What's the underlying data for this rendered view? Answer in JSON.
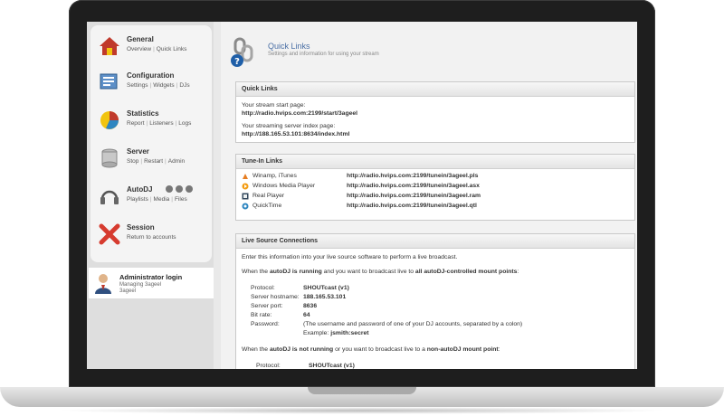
{
  "nav": {
    "general": {
      "title": "General",
      "links": [
        "Overview",
        "Quick Links"
      ]
    },
    "configuration": {
      "title": "Configuration",
      "links": [
        "Settings",
        "Widgets",
        "DJs"
      ]
    },
    "statistics": {
      "title": "Statistics",
      "links": [
        "Report",
        "Listeners",
        "Logs"
      ]
    },
    "server": {
      "title": "Server",
      "links": [
        "Stop",
        "Restart",
        "Admin"
      ]
    },
    "autodj": {
      "title": "AutoDJ",
      "links": [
        "Playlists",
        "Media",
        "Files"
      ]
    },
    "session": {
      "title": "Session",
      "links": [
        "Return to accounts"
      ]
    }
  },
  "login": {
    "title": "Administrator login",
    "sub1": "Managing 3ageel",
    "sub2": "3ageel"
  },
  "header": {
    "title": "Quick Links",
    "subtitle": "Settings and information for using your stream"
  },
  "quick_links": {
    "title": "Quick Links",
    "start_label": "Your stream start page:",
    "start_url": "http://radio.hvips.com:2199/start/3ageel",
    "index_label": "Your streaming server index page:",
    "index_url": "http://188.165.53.101:8634/index.html"
  },
  "tunein": {
    "title": "Tune-In Links",
    "rows": [
      {
        "player": "Winamp, iTunes",
        "icon": "winamp-icon",
        "url": "http://radio.hvips.com:2199/tunein/3ageel.pls"
      },
      {
        "player": "Windows Media Player",
        "icon": "windows-media-player-icon",
        "url": "http://radio.hvips.com:2199/tunein/3ageel.asx"
      },
      {
        "player": "Real Player",
        "icon": "real-player-icon",
        "url": "http://radio.hvips.com:2199/tunein/3ageel.ram"
      },
      {
        "player": "QuickTime",
        "icon": "quicktime-icon",
        "url": "http://radio.hvips.com:2199/tunein/3ageel.qtl"
      }
    ]
  },
  "live": {
    "title": "Live Source Connections",
    "intro": "Enter this information into your live source software to perform a live broadcast.",
    "autodj_on_1": "When the ",
    "autodj_on_2": "autoDJ is running",
    "autodj_on_3": " and you want to broadcast live to ",
    "autodj_on_4": "all autoDJ-controlled mount points",
    "autodj_on_5": ":",
    "fields": [
      {
        "label": "Protocol:",
        "value": "SHOUTcast (v1)"
      },
      {
        "label": "Server hostname:",
        "value": "188.165.53.101"
      },
      {
        "label": "Server port:",
        "value": "8636"
      },
      {
        "label": "Bit rate:",
        "value": "64"
      },
      {
        "label": "Password:",
        "value": "(The username and password of one of your DJ accounts, separated by a colon)"
      }
    ],
    "example_label": "Example: ",
    "example_value": "jsmith:secret",
    "autodj_off_1": "When the ",
    "autodj_off_2": "autoDJ is not running",
    "autodj_off_3": " or you want to broadcast live to a ",
    "autodj_off_4": "non-autoDJ mount point",
    "autodj_off_5": ":",
    "protocol2_label": "Protocol:",
    "protocol2_value": "SHOUTcast (v1)"
  }
}
